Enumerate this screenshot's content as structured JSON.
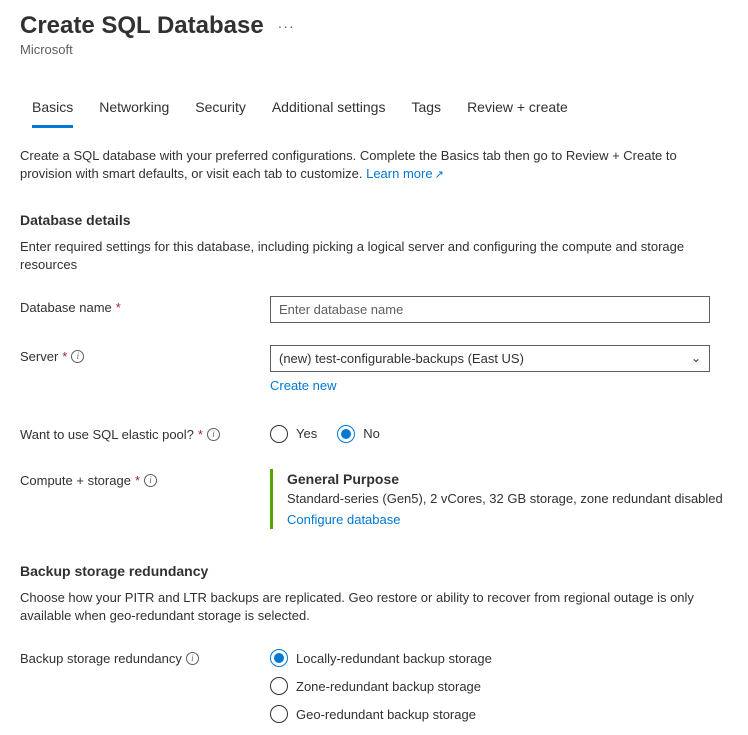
{
  "header": {
    "title": "Create SQL Database",
    "subtitle": "Microsoft"
  },
  "tabs": [
    {
      "label": "Basics",
      "active": true
    },
    {
      "label": "Networking",
      "active": false
    },
    {
      "label": "Security",
      "active": false
    },
    {
      "label": "Additional settings",
      "active": false
    },
    {
      "label": "Tags",
      "active": false
    },
    {
      "label": "Review + create",
      "active": false
    }
  ],
  "intro": {
    "text": "Create a SQL database with your preferred configurations. Complete the Basics tab then go to Review + Create to provision with smart defaults, or visit each tab to customize. ",
    "link": "Learn more"
  },
  "database_details": {
    "title": "Database details",
    "desc": "Enter required settings for this database, including picking a logical server and configuring the compute and storage resources",
    "db_name_label": "Database name",
    "db_name_placeholder": "Enter database name",
    "server_label": "Server",
    "server_value": "(new) test-configurable-backups (East US)",
    "create_new": "Create new",
    "elastic_label": "Want to use SQL elastic pool?",
    "elastic_yes": "Yes",
    "elastic_no": "No",
    "compute_label": "Compute + storage",
    "compute_title": "General Purpose",
    "compute_desc": "Standard-series (Gen5), 2 vCores, 32 GB storage, zone redundant disabled",
    "compute_link": "Configure database"
  },
  "backup": {
    "title": "Backup storage redundancy",
    "desc": "Choose how your PITR and LTR backups are replicated. Geo restore or ability to recover from regional outage is only available when geo-redundant storage is selected.",
    "label": "Backup storage redundancy",
    "opt_local": "Locally-redundant backup storage",
    "opt_zone": "Zone-redundant backup storage",
    "opt_geo": "Geo-redundant backup storage"
  }
}
